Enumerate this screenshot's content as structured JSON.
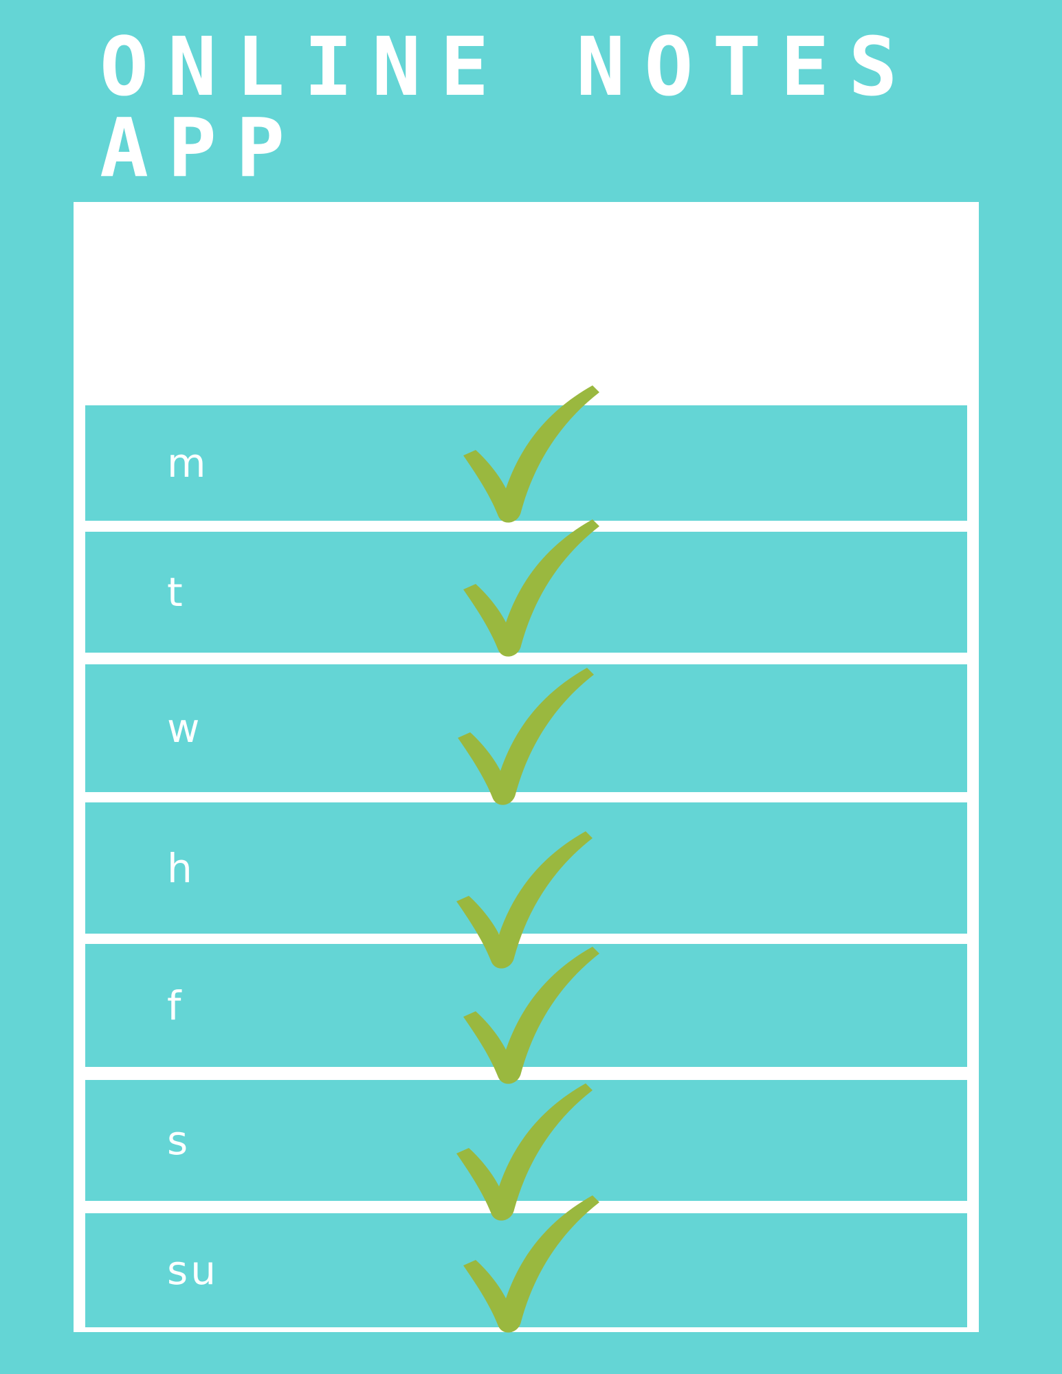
{
  "app": {
    "title_line1": "ONLINE NOTES",
    "title_line2": "APP"
  },
  "colors": {
    "background": "#64d5d5",
    "panel": "#ffffff",
    "check": "#9ab83f",
    "text": "#ffffff"
  },
  "days": [
    {
      "label": "m",
      "checked": true,
      "icon": "checkmark-icon"
    },
    {
      "label": "t",
      "checked": true,
      "icon": "checkmark-icon"
    },
    {
      "label": "w",
      "checked": true,
      "icon": "checkmark-icon"
    },
    {
      "label": "h",
      "checked": true,
      "icon": "checkmark-icon"
    },
    {
      "label": "f",
      "checked": true,
      "icon": "checkmark-icon"
    },
    {
      "label": "s",
      "checked": true,
      "icon": "checkmark-icon"
    },
    {
      "label": "su",
      "checked": true,
      "icon": "checkmark-icon"
    }
  ]
}
